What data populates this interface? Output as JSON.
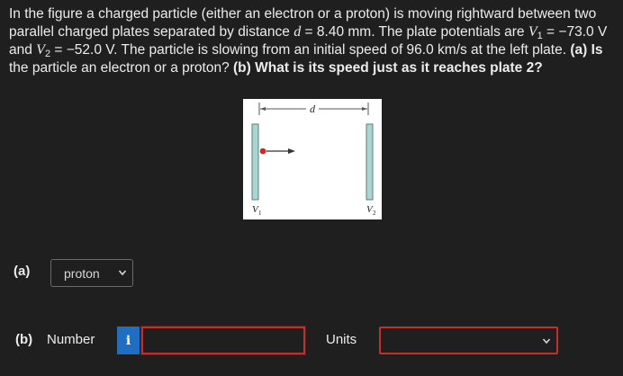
{
  "problem": {
    "line1_a": "In the figure a charged particle (either an electron or a proton) is moving rightward between two",
    "line2_a": "parallel charged plates separated by distance ",
    "line2_d": "d",
    "line2_b": " = 8.40 mm. The plate potentials are ",
    "line2_v1": "V",
    "line2_v1sub": "1",
    "line2_c": " = −73.0 V",
    "line3_a": "and ",
    "line3_v2": "V",
    "line3_v2sub": "2",
    "line3_b": " = −52.0 V. The particle is slowing from an initial speed of 96.0 km/s at the left plate. ",
    "line3_qa": "(a)",
    "line3_c": " Is",
    "line4_a": "the particle an electron or a proton? ",
    "line4_qb": "(b)",
    "line4_b": " What is its speed just as it reaches plate 2?"
  },
  "figure": {
    "d_label": "d",
    "v1_label": "V",
    "v1_sub": "1",
    "v2_label": "V",
    "v2_sub": "2"
  },
  "part_a": {
    "label": "(a)",
    "selected_value": "proton"
  },
  "part_b": {
    "label": "(b)",
    "number_label": "Number",
    "info_icon": "i",
    "number_value": "",
    "units_label": "Units",
    "units_value": ""
  },
  "colors": {
    "background": "#1f1f1f",
    "error_border": "#c43028",
    "info_button": "#1e6fc2",
    "plate_fill": "#a9d6d2",
    "particle": "#e02020"
  }
}
